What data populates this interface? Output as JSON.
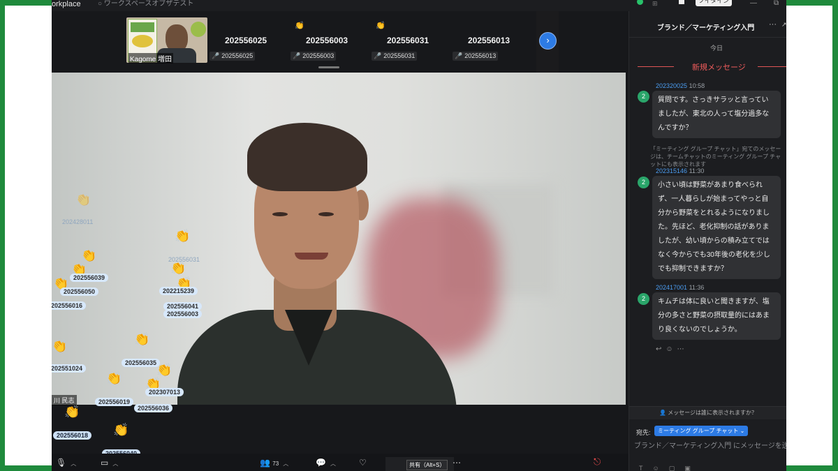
{
  "window": {
    "app_name": "orkplace",
    "subtitle": "○ ワークスペースオブザテスト",
    "button_label": "ツイタイン",
    "controls": [
      "—",
      "⧉"
    ]
  },
  "strip": {
    "thumb_label": "Kagome 増田",
    "tiles": [
      {
        "id": "202556025",
        "sub": "202556025"
      },
      {
        "id": "202556003",
        "sub": "202556003"
      },
      {
        "id": "202556031",
        "sub": "202556031"
      },
      {
        "id": "202556013",
        "sub": "202556013"
      }
    ],
    "next_icon": "chevron-right-icon"
  },
  "reactions": [
    {
      "id": "202428011",
      "faint": true
    },
    {
      "id": "202556031",
      "faint": true
    },
    {
      "id": "202556039"
    },
    {
      "id": "202556050"
    },
    {
      "id": "202215239"
    },
    {
      "id": "202556016"
    },
    {
      "id": "202556041"
    },
    {
      "id": "202556003"
    },
    {
      "id": "202551024"
    },
    {
      "id": "202556035"
    },
    {
      "id": "202307013"
    },
    {
      "id": "202556019"
    },
    {
      "id": "202556036"
    },
    {
      "id": "202556018"
    },
    {
      "id": "202556040"
    }
  ],
  "speaker": {
    "name": "川 民志"
  },
  "bottombar": {
    "participants_count": "73",
    "share_tip": "共有（Alt+S）"
  },
  "chat": {
    "title": "ブランド／マーケティング入門",
    "more_icon": "···",
    "today": "今日",
    "new_messages": "新規メッセージ",
    "messages": [
      {
        "avatar": "2",
        "sender": "202320025",
        "time": "10:58",
        "text": "質問です。さっきサラッと言っていましたが、東北の人って塩分過多なんですか？"
      },
      {
        "avatar": "2",
        "sender": "202315146",
        "time": "11:30",
        "text": "小さい頃は野菜があまり食べられず、一人暮らしが始まってやっと自分から野菜をとれるようになりました。先ほど、老化抑制の話がありましたが、幼い頃からの積み立てではなく今からでも30年後の老化を少しでも抑制できますか？"
      },
      {
        "avatar": "2",
        "sender": "202417001",
        "time": "11:36",
        "text": "キムチは体に良いと聞きますが、塩分の多さと野菜の摂取量的にはあまり良くないのでしょうか。"
      }
    ],
    "system_note": "「ミーティング グループ チャット」宛てのメッセージは、チームチャットのミーティング グループ チャットにも表示されます",
    "who_sees": "メッセージは誰に表示されますか？",
    "to_label": "宛先:",
    "to_value": "ミーティング グループ チャット ⌄",
    "input_placeholder": "ブランド／マーケティング入門 にメッセージを送信"
  }
}
